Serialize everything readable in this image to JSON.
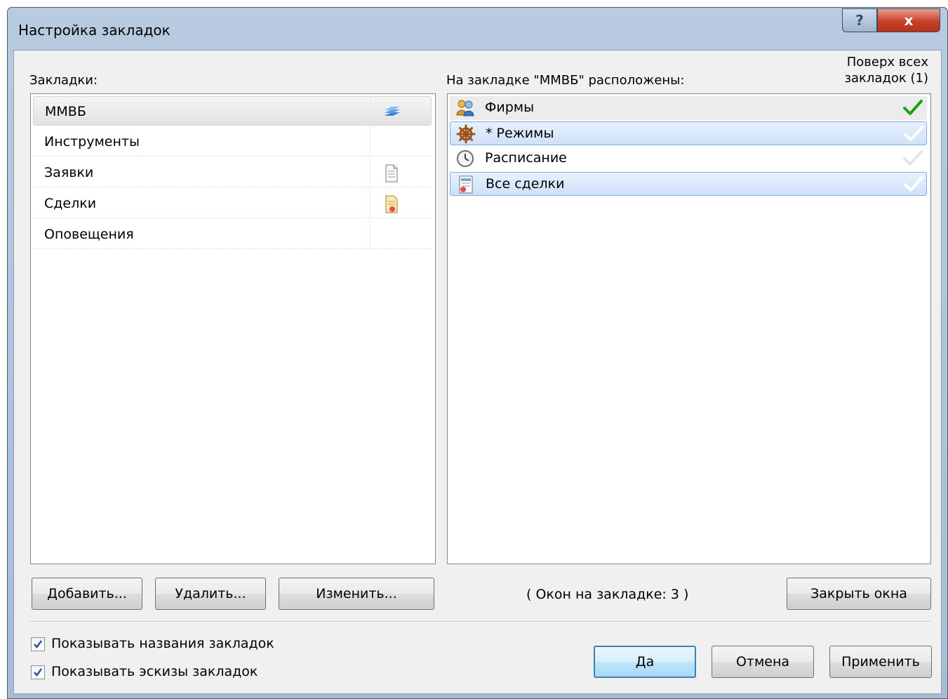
{
  "window": {
    "title": "Настройка закладок",
    "help_label": "?",
    "close_label": "x"
  },
  "left": {
    "label": "Закладки:",
    "items": [
      {
        "label": "ММВБ",
        "icon": "stack-icon",
        "selected": true
      },
      {
        "label": "Инструменты",
        "icon": ""
      },
      {
        "label": "Заявки",
        "icon": "document-icon"
      },
      {
        "label": "Сделки",
        "icon": "certificate-icon"
      },
      {
        "label": "Оповещения",
        "icon": ""
      }
    ]
  },
  "right": {
    "label": "На закладке \"ММВБ\" расположены:",
    "on_top_header_line1": "Поверх всех",
    "on_top_header_line2": "закладок (1)",
    "items": [
      {
        "label": "Фирмы",
        "icon": "users-icon",
        "on_top": true
      },
      {
        "label": "* Режимы",
        "icon": "wheel-icon",
        "on_top": false
      },
      {
        "label": "Расписание",
        "icon": "clock-icon",
        "on_top": false
      },
      {
        "label": "Все сделки",
        "icon": "deals-icon",
        "on_top": false
      }
    ]
  },
  "buttons": {
    "add": "Добавить...",
    "delete": "Удалить...",
    "edit": "Изменить...",
    "close_windows": "Закрыть окна",
    "ok": "Да",
    "cancel": "Отмена",
    "apply": "Применить"
  },
  "status": {
    "windows_count": "( Окон на закладке: 3 )"
  },
  "options": {
    "show_names": {
      "label": "Показывать названия закладок",
      "checked": true
    },
    "show_thumbnails": {
      "label": "Показывать эскизы закладок",
      "checked": true
    }
  },
  "colors": {
    "title_bar": "#b9cbe0",
    "close_button": "#c7402a",
    "selection_blue": "#cfe1f7",
    "check_green": "#1e9e1e"
  }
}
